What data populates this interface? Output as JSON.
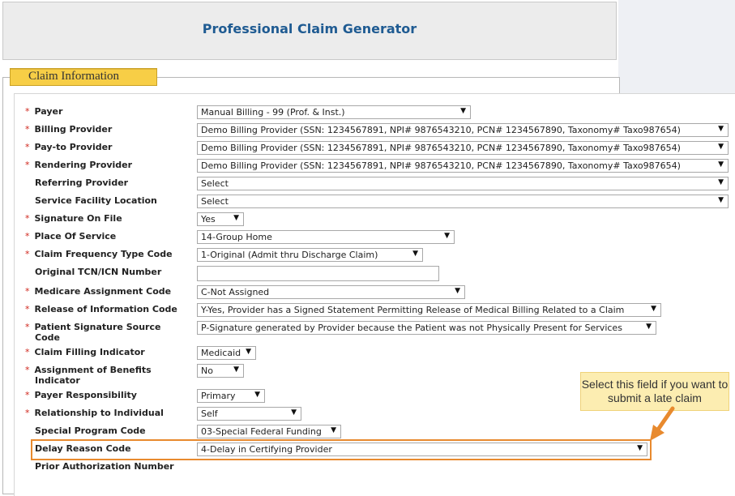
{
  "header": {
    "title": "Professional Claim Generator"
  },
  "section": {
    "legend": "Claim Information"
  },
  "form": {
    "fields": [
      {
        "label": "Payer",
        "required": true,
        "value": "Manual Billing - 99 (Prof. & Inst.)"
      },
      {
        "label": "Billing Provider",
        "required": true,
        "value": "Demo Billing Provider (SSN: 1234567891, NPI# 9876543210, PCN# 1234567890, Taxonomy# Taxo987654)"
      },
      {
        "label": "Pay-to Provider",
        "required": true,
        "value": "Demo Billing Provider (SSN: 1234567891, NPI# 9876543210, PCN# 1234567890, Taxonomy# Taxo987654)"
      },
      {
        "label": "Rendering Provider",
        "required": true,
        "value": "Demo Billing Provider (SSN: 1234567891, NPI# 9876543210, PCN# 1234567890, Taxonomy# Taxo987654)"
      },
      {
        "label": "Referring Provider",
        "required": false,
        "value": "Select"
      },
      {
        "label": "Service Facility Location",
        "required": false,
        "value": "Select"
      },
      {
        "label": "Signature On File",
        "required": true,
        "value": "Yes"
      },
      {
        "label": "Place Of Service",
        "required": true,
        "value": "14-Group Home"
      },
      {
        "label": "Claim Frequency Type Code",
        "required": true,
        "value": "1-Original (Admit thru Discharge Claim)"
      },
      {
        "label": "Original TCN/ICN Number",
        "required": false,
        "value": ""
      },
      {
        "label": "Medicare Assignment Code",
        "required": true,
        "value": "C-Not Assigned"
      },
      {
        "label": "Release of Information Code",
        "required": true,
        "value": "Y-Yes, Provider has a Signed Statement Permitting Release of Medical Billing Related to a Claim"
      },
      {
        "label": "Patient Signature Source Code",
        "required": true,
        "value": "P-Signature generated by Provider because the Patient was not Physically Present for Services"
      },
      {
        "label": "Claim Filling Indicator",
        "required": true,
        "value": "Medicaid"
      },
      {
        "label": "Assignment of Benefits Indicator",
        "required": true,
        "value": "No"
      },
      {
        "label": "Payer Responsibility",
        "required": true,
        "value": "Primary"
      },
      {
        "label": "Relationship to Individual",
        "required": true,
        "value": "Self"
      },
      {
        "label": "Special Program Code",
        "required": false,
        "value": "03-Special Federal Funding"
      },
      {
        "label": "Delay Reason Code",
        "required": false,
        "value": "4-Delay in Certifying Provider"
      },
      {
        "label": "Prior Authorization Number",
        "required": false,
        "value": ""
      }
    ]
  },
  "callout": {
    "text": "Select this field if you want to submit a late claim"
  },
  "colors": {
    "title": "#1f5b92",
    "legend_bg": "#f7ce46",
    "highlight": "#e88a2e",
    "callout_bg": "#fcedb1",
    "required": "#d0271d"
  },
  "icons": {
    "dropdown": "chevron-down-icon",
    "arrow": "orange-pointer-arrow"
  }
}
